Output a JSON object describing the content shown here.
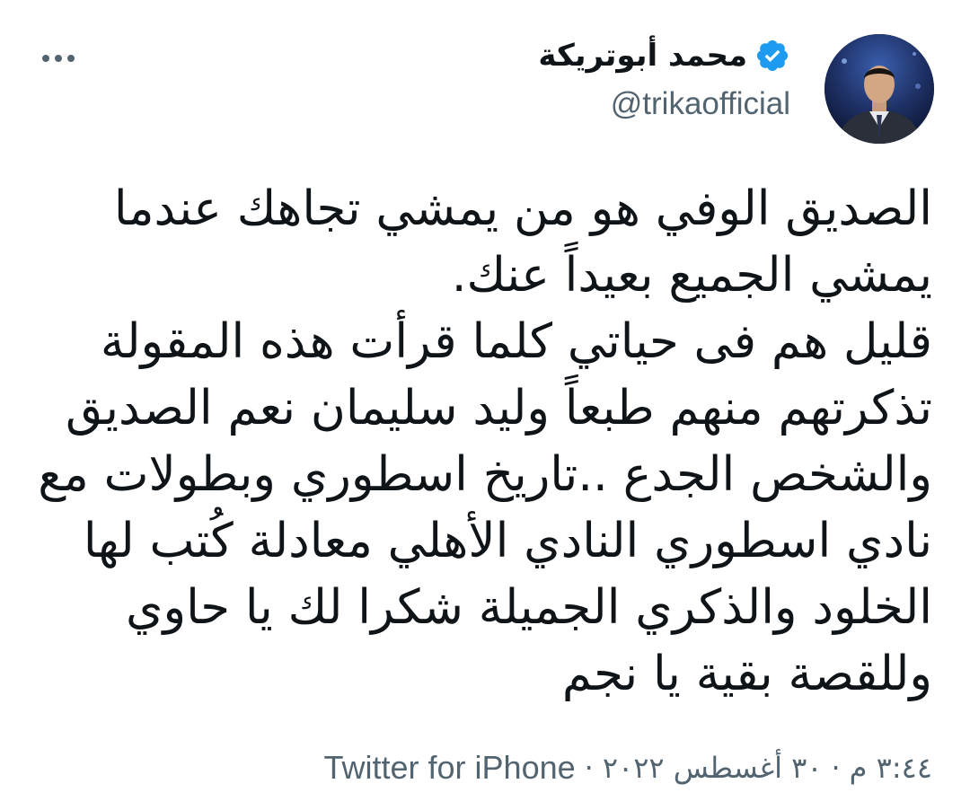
{
  "header": {
    "display_name": "محمد أبوتريكة",
    "handle": "@trikaofficial",
    "verified": true,
    "verified_icon": "verified-badge-icon",
    "more_icon": "more-horizontal-icon",
    "avatar_icon": "avatar-photo"
  },
  "tweet": {
    "lines": [
      "الصديق الوفي هو من يمشي تجاهك عندما",
      "يمشي الجميع بعيداً عنك.",
      "قليل هم فى حياتي كلما قرأت هذه المقولة",
      "تذكرتهم منهم طبعاً وليد سليمان نعم الصديق",
      "والشخص الجدع ..تاريخ اسطوري وبطولات مع",
      "نادي اسطوري النادي الأهلي معادلة كُتب لها",
      "الخلود والذكري الجميلة شكرا لك يا حاوي",
      "وللقصة بقية يا نجم"
    ]
  },
  "meta": {
    "time": "٣:٤٤ م",
    "separator_1": "·",
    "date": "٣٠ أغسطس ٢٠٢٢",
    "separator_2": "·",
    "source": "Twitter for iPhone"
  },
  "colors": {
    "text_primary": "#0f1419",
    "text_secondary": "#536471",
    "verified_blue": "#1d9bf0",
    "background": "#ffffff"
  }
}
